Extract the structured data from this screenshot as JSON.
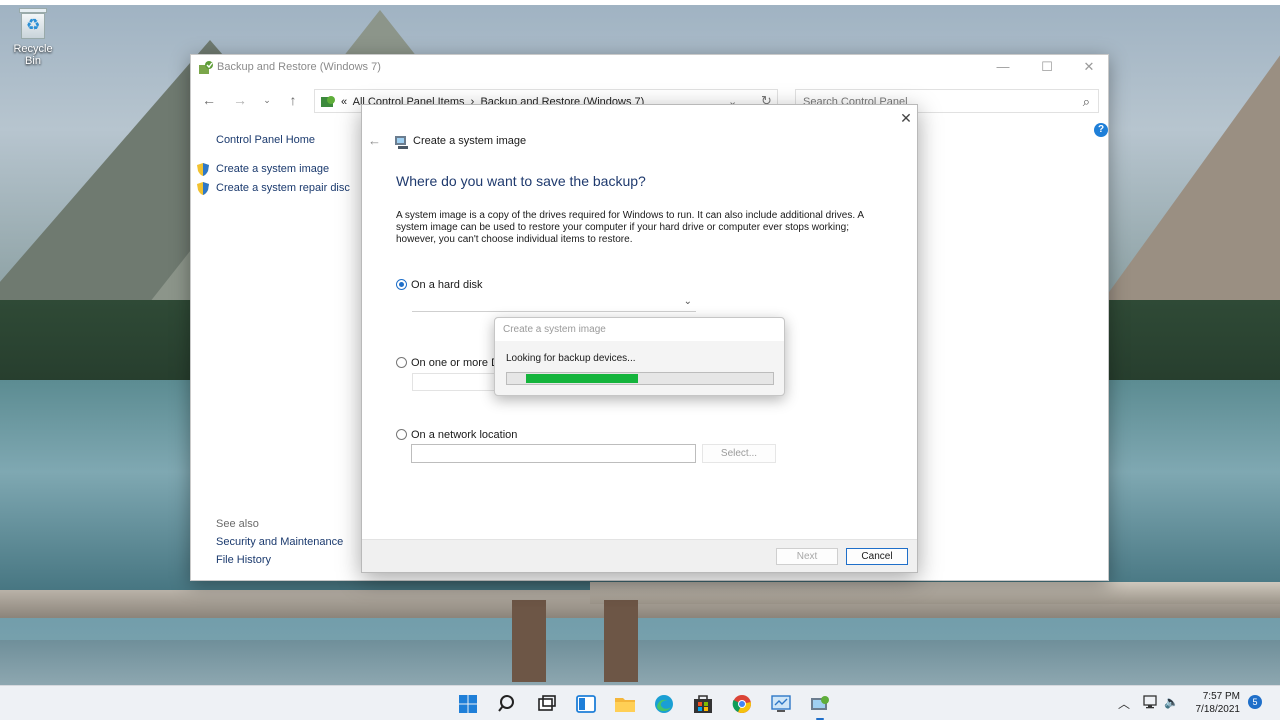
{
  "desktop": {
    "recycle_bin_label": "Recycle Bin"
  },
  "window": {
    "title": "Backup and Restore (Windows 7)",
    "controls": {
      "minimize": "—",
      "maximize": "☐",
      "close": "✕"
    },
    "address": {
      "prefix": "«",
      "crumb1": "All Control Panel Items",
      "separator": "›",
      "crumb2": "Backup and Restore (Windows 7)"
    },
    "search_placeholder": "Search Control Panel"
  },
  "left_panel": {
    "home": "Control Panel Home",
    "links": [
      "Create a system image",
      "Create a system repair disc"
    ],
    "see_also": "See also",
    "see_also_links": [
      "Security and Maintenance",
      "File History"
    ]
  },
  "dialog": {
    "title": "Create a system image",
    "heading": "Where do you want to save the backup?",
    "description": "A system image is a copy of the drives required for Windows to run. It can also include additional drives. A system image can be used to restore your computer if your hard drive or computer ever stops working; however, you can't choose individual items to restore.",
    "options": {
      "hard_disk": "On a hard disk",
      "dvds": "On one or more D",
      "network": "On a network location"
    },
    "selected_option": "hard_disk",
    "select_button": "Select...",
    "next_button": "Next",
    "cancel_button": "Cancel"
  },
  "progress_popup": {
    "title": "Create a system image",
    "message": "Looking for backup devices...",
    "progress_start": 0.07,
    "progress_end": 0.49
  },
  "taskbar": {
    "time": "7:57 PM",
    "date": "7/18/2021",
    "notification_count": "5",
    "icons": [
      "windows-start-icon",
      "search-icon",
      "task-view-icon",
      "widgets-icon",
      "file-explorer-icon",
      "edge-icon",
      "store-icon",
      "chrome-icon",
      "remote-desktop-icon",
      "control-panel-icon"
    ]
  },
  "colors": {
    "accent": "#1f6fc9",
    "heading": "#1f3a6e",
    "progress": "#14b43c"
  }
}
